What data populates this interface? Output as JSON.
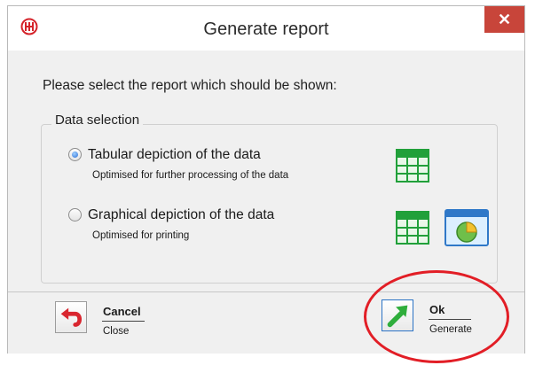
{
  "window": {
    "title": "Generate report",
    "close_glyph": "✕"
  },
  "prompt": "Please select the report which should be shown:",
  "group": {
    "legend": "Data selection",
    "options": [
      {
        "title": "Tabular depiction of the data",
        "subtitle": "Optimised for further processing of the data",
        "selected": true
      },
      {
        "title": "Graphical depiction of the data",
        "subtitle": "Optimised for printing",
        "selected": false
      }
    ]
  },
  "footer": {
    "cancel": {
      "label": "Cancel",
      "sub": "Close"
    },
    "ok": {
      "label": "Ok",
      "sub": "Generate"
    }
  },
  "colors": {
    "close": "#c8453a",
    "grid_green": "#21a03a",
    "accent_red": "#e21e26",
    "ok_green": "#2fae3c"
  },
  "icons": {
    "app": "app-logo-icon",
    "close": "close-icon",
    "table": "table-grid-icon",
    "chart": "chart-window-icon",
    "cancel": "undo-arrow-icon",
    "ok": "arrow-up-right-icon"
  }
}
